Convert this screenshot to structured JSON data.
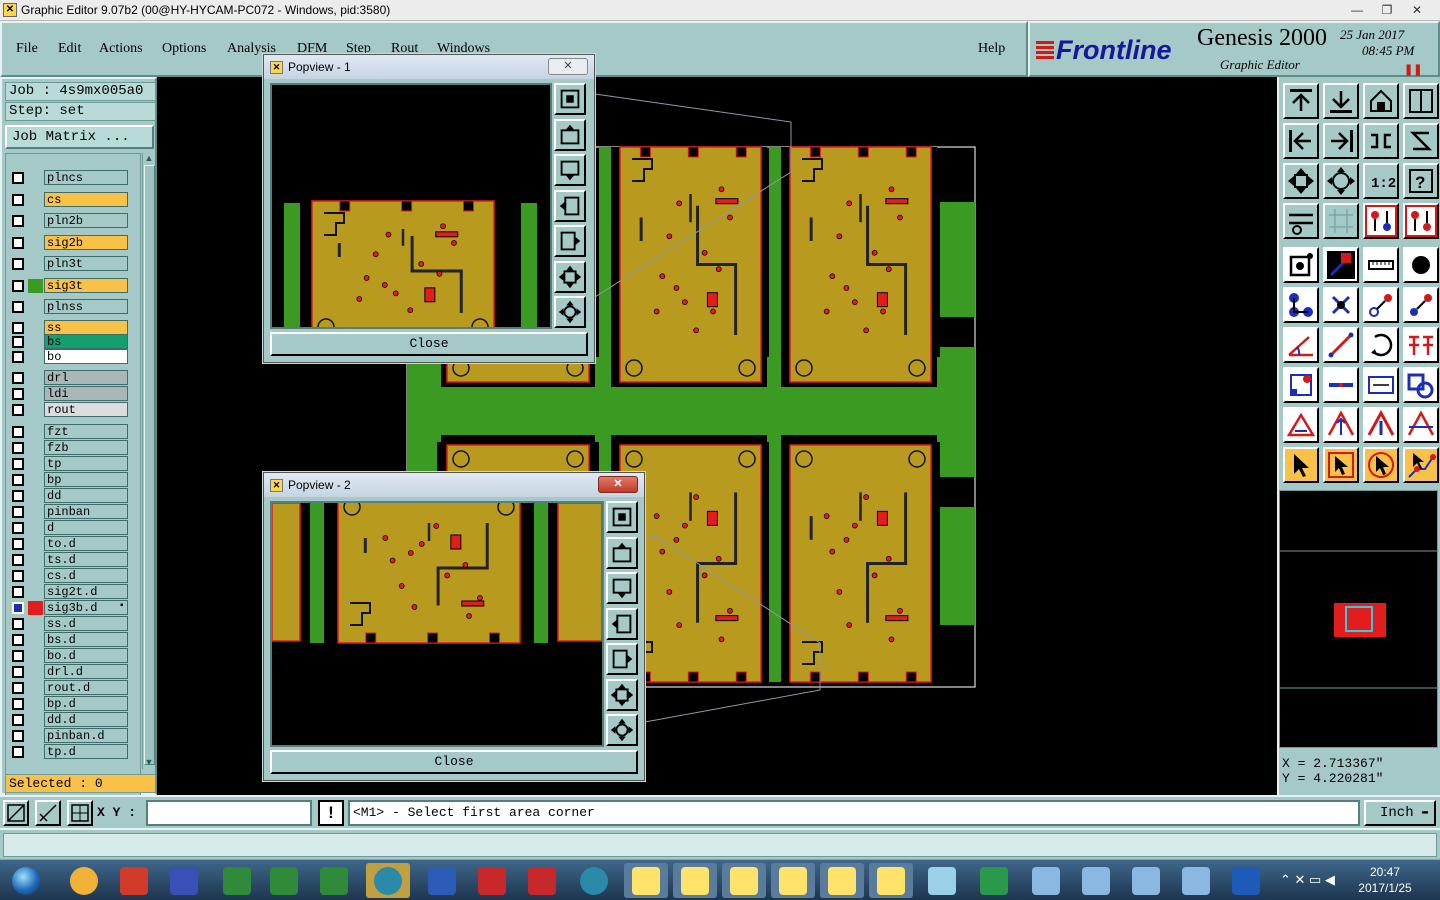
{
  "window": {
    "title": "Graphic Editor 9.07b2 (00@HY-HYCAM-PC072 - Windows, pid:3580)"
  },
  "menu": {
    "items": [
      "File",
      "Edit",
      "Actions",
      "Options",
      "Analysis",
      "DFM",
      "Step",
      "Rout",
      "Windows"
    ],
    "help": "Help"
  },
  "brand": {
    "logo": "Frontline",
    "product": "Genesis 2000",
    "subtitle": "Graphic Editor",
    "date": "25 Jan 2017",
    "time": "08:45 PM"
  },
  "job": {
    "job_label": "Job : 4s9mx005a0",
    "step_label": "Step: set",
    "matrix_button": "Job Matrix ..."
  },
  "layers": [
    {
      "name": "plncs",
      "bg": "#a4c9c7"
    },
    {
      "name": "cs",
      "bg": "#f9c147"
    },
    {
      "name": "pln2b",
      "bg": "#a4c9c7"
    },
    {
      "name": "sig2b",
      "bg": "#f9c147"
    },
    {
      "name": "pln3t",
      "bg": "#a4c9c7"
    },
    {
      "name": "sig3t",
      "bg": "#f9c147",
      "swatch": "#3a9a22"
    },
    {
      "name": "plnss",
      "bg": "#a4c9c7"
    },
    {
      "name": "ss",
      "bg": "#f9c147"
    },
    {
      "name": "bs",
      "bg": "#12a06e"
    },
    {
      "name": "bo",
      "bg": "#ffffff"
    },
    {
      "name": "drl",
      "bg": "#a9b7b6"
    },
    {
      "name": "ldi",
      "bg": "#a9b7b6"
    },
    {
      "name": "rout",
      "bg": "#dcdcdc"
    },
    {
      "name": "fzt",
      "bg": "#a4c9c7"
    },
    {
      "name": "fzb",
      "bg": "#a4c9c7"
    },
    {
      "name": "tp",
      "bg": "#a4c9c7"
    },
    {
      "name": "bp",
      "bg": "#a4c9c7"
    },
    {
      "name": "dd",
      "bg": "#a4c9c7"
    },
    {
      "name": "pinban",
      "bg": "#a4c9c7"
    },
    {
      "name": "d",
      "bg": "#a4c9c7"
    },
    {
      "name": "to.d",
      "bg": "#a4c9c7"
    },
    {
      "name": "ts.d",
      "bg": "#a4c9c7"
    },
    {
      "name": "cs.d",
      "bg": "#a4c9c7"
    },
    {
      "name": "sig2t.d",
      "bg": "#a4c9c7"
    },
    {
      "name": "sig3b.d",
      "bg": "#a4c9c7",
      "swatch": "#e21d1d",
      "active": true
    },
    {
      "name": "ss.d",
      "bg": "#a4c9c7"
    },
    {
      "name": "bs.d",
      "bg": "#a4c9c7"
    },
    {
      "name": "bo.d",
      "bg": "#a4c9c7"
    },
    {
      "name": "drl.d",
      "bg": "#a4c9c7"
    },
    {
      "name": "rout.d",
      "bg": "#a4c9c7"
    },
    {
      "name": "bp.d",
      "bg": "#a4c9c7"
    },
    {
      "name": "dd.d",
      "bg": "#a4c9c7"
    },
    {
      "name": "pinban.d",
      "bg": "#a4c9c7"
    },
    {
      "name": "tp.d",
      "bg": "#a4c9c7"
    }
  ],
  "selected": "Selected : 0",
  "coords": {
    "x": "X = 2.713367\"",
    "y": "Y = 4.220281\""
  },
  "bottom": {
    "xy_label": "X Y :",
    "xy_value": "",
    "warn": "!",
    "message": "<M1> - Select first area corner",
    "unit": "Inch"
  },
  "popview1": {
    "title": "Popview - 1",
    "close": "Close"
  },
  "popview2": {
    "title": "Popview - 2",
    "close": "Close"
  },
  "toolbar": {
    "ratio_label": "1:2",
    "help_label": "?"
  },
  "taskbar": {
    "time": "20:47",
    "date": "2017/1/25"
  },
  "colors": {
    "panel": "#a4c9c7",
    "board_copper": "#b89a1e",
    "board_green": "#3a9a22",
    "outline_red": "#e21d1d"
  }
}
